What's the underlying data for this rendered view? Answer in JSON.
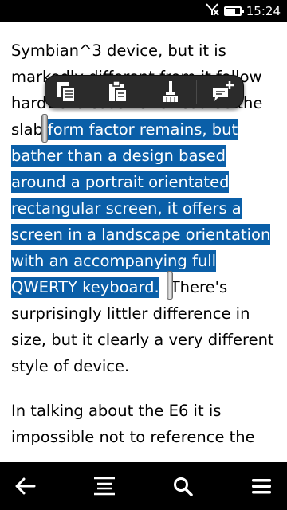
{
  "status_bar": {
    "time": "15:24",
    "battery_level": 0.8,
    "icons": [
      "no-signal-icon",
      "battery-icon"
    ]
  },
  "article": {
    "para1_lines": [
      "Symbian^3 device, but it is",
      "markedly different from it follow",
      "hardware cousins. Of course the",
      "slab",
      "form factor remains, but",
      "bather than a design based",
      "around a portrait orientated",
      "rectangular screen, it offers a",
      "screen in a landscape orientation",
      "with an accompanying full",
      "QWERTY keyboard.",
      "There's",
      "surprisingly littler difference in",
      "size, but it clearly a very different",
      "style of device."
    ],
    "para2_lines": [
      "In talking about the E6 it is",
      "impossible not to reference the"
    ]
  },
  "context_toolbar": {
    "items": [
      "copy-icon",
      "paste-icon",
      "brush-icon",
      "add-note-icon"
    ]
  },
  "bottom_bar": {
    "items": [
      "back-arrow-icon",
      "list-icon",
      "search-icon",
      "menu-icon"
    ]
  },
  "colors": {
    "selection": "#0a5fa8",
    "toolbar": "#2b2b2b",
    "bar": "#000000"
  }
}
